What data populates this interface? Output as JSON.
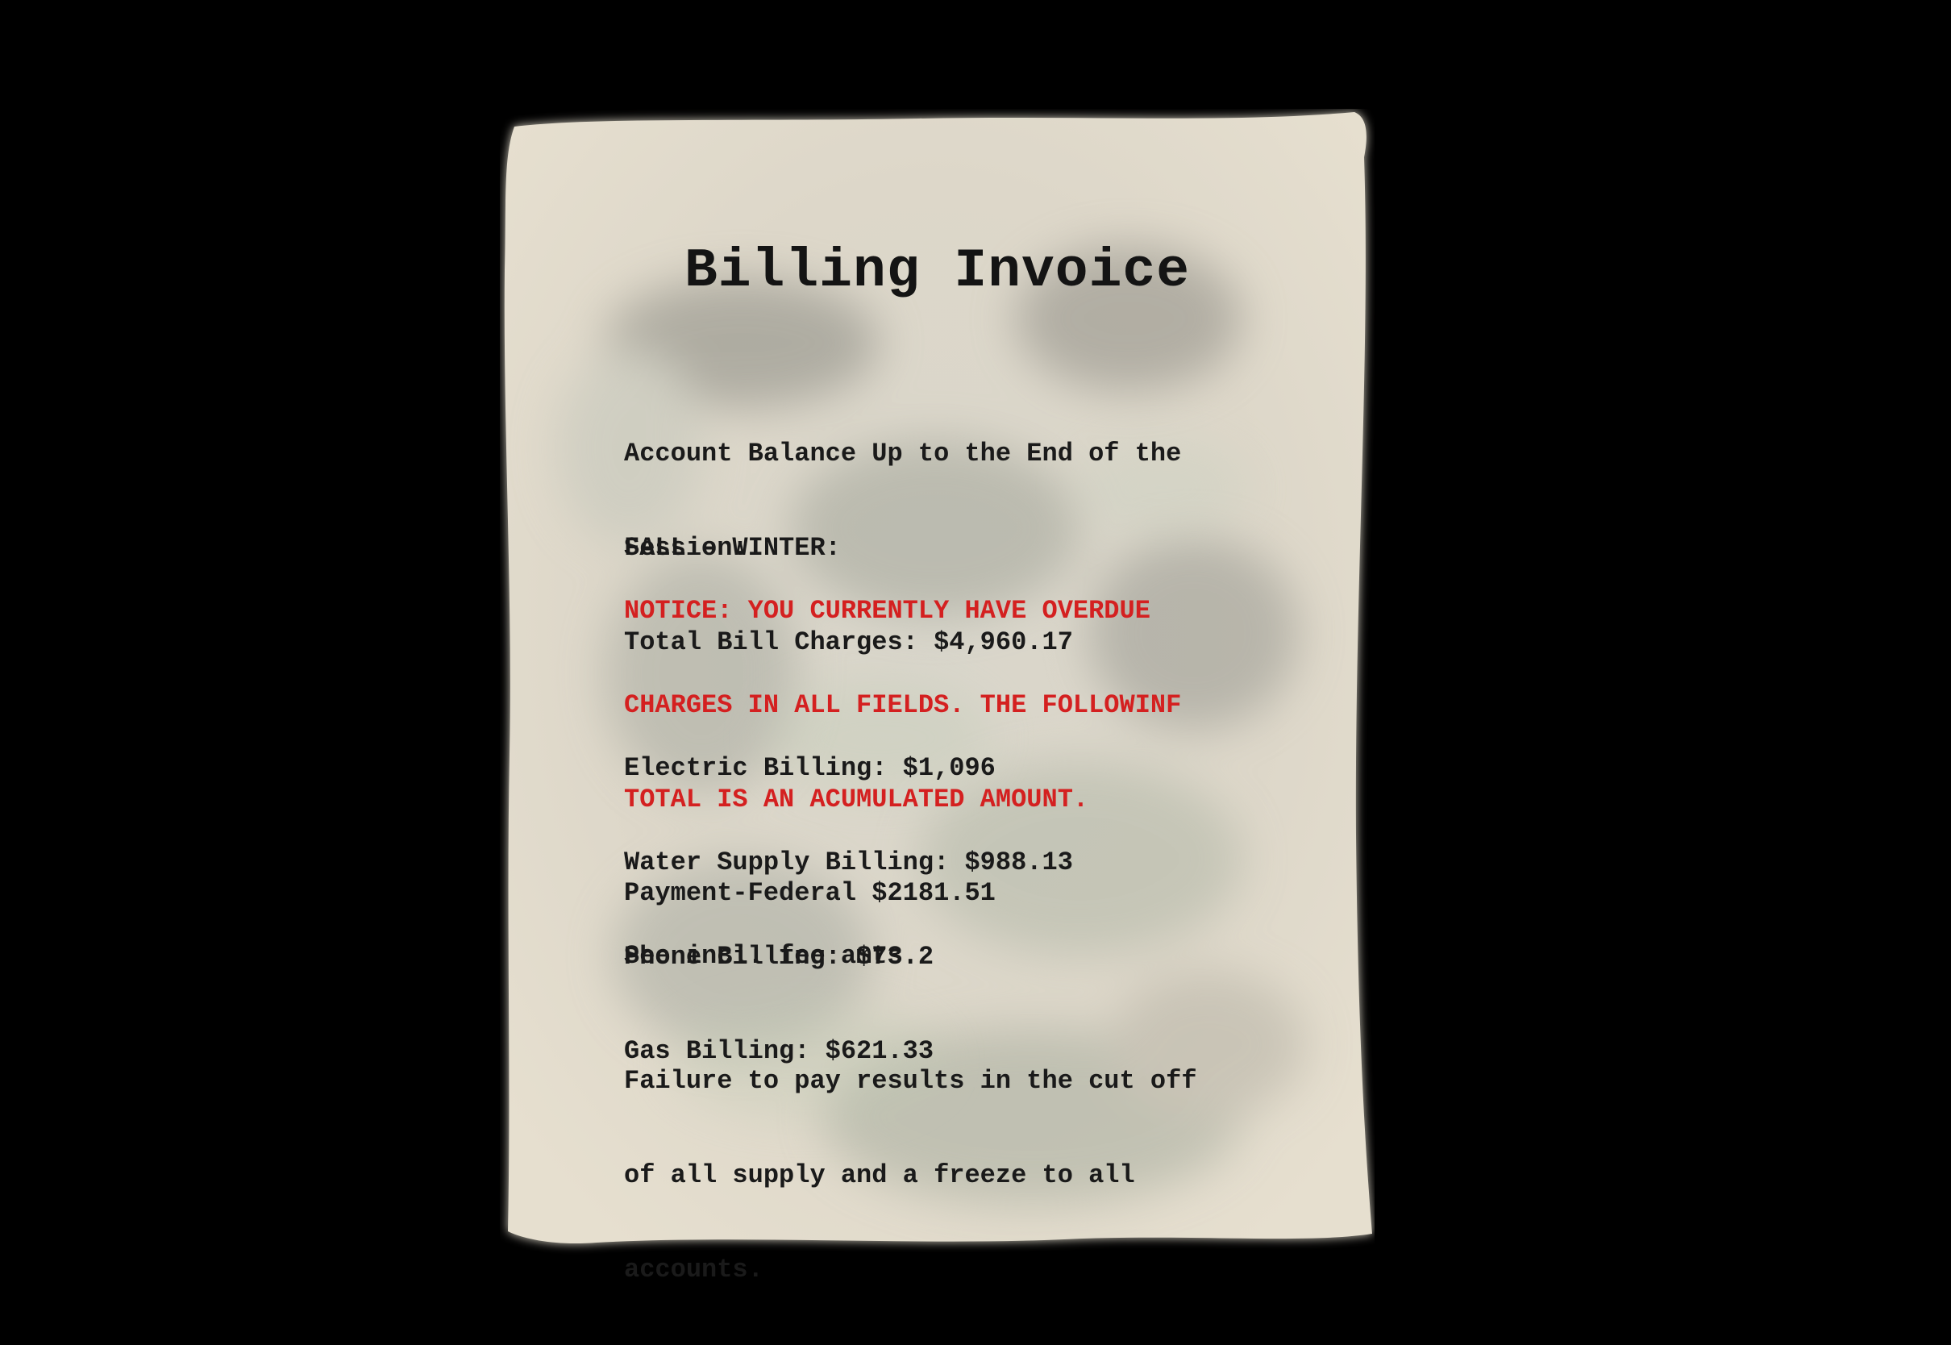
{
  "invoice": {
    "title": "Billing Invoice",
    "account_balance": [
      "Account Balance Up to the End of the",
      "Session:"
    ],
    "season": "FALL - WINTER:",
    "total_charges": "Total Bill Charges: $4,960.17",
    "notice": [
      "NOTICE: YOU CURRENTLY HAVE OVERDUE",
      "CHARGES IN ALL FIELDS. THE FOLLOWINF",
      "TOTAL IS AN ACUMULATED AMOUNT."
    ],
    "bills": [
      "Electric Billing: $1,096",
      "Water Supply Billing: $988.13",
      "Phone Billing: $73.2",
      "Gas Billing: $621.33"
    ],
    "payment": "Payment-Federal $2181.51",
    "fee_note": "See incl. fee amts.",
    "failure_warning": [
      "Failure to pay results in the cut off",
      "of all supply and a freeze to all",
      "accounts."
    ]
  },
  "colors": {
    "background": "#000000",
    "paper": "#e3dccd",
    "text": "#1a1a1a",
    "notice": "#d42020"
  }
}
